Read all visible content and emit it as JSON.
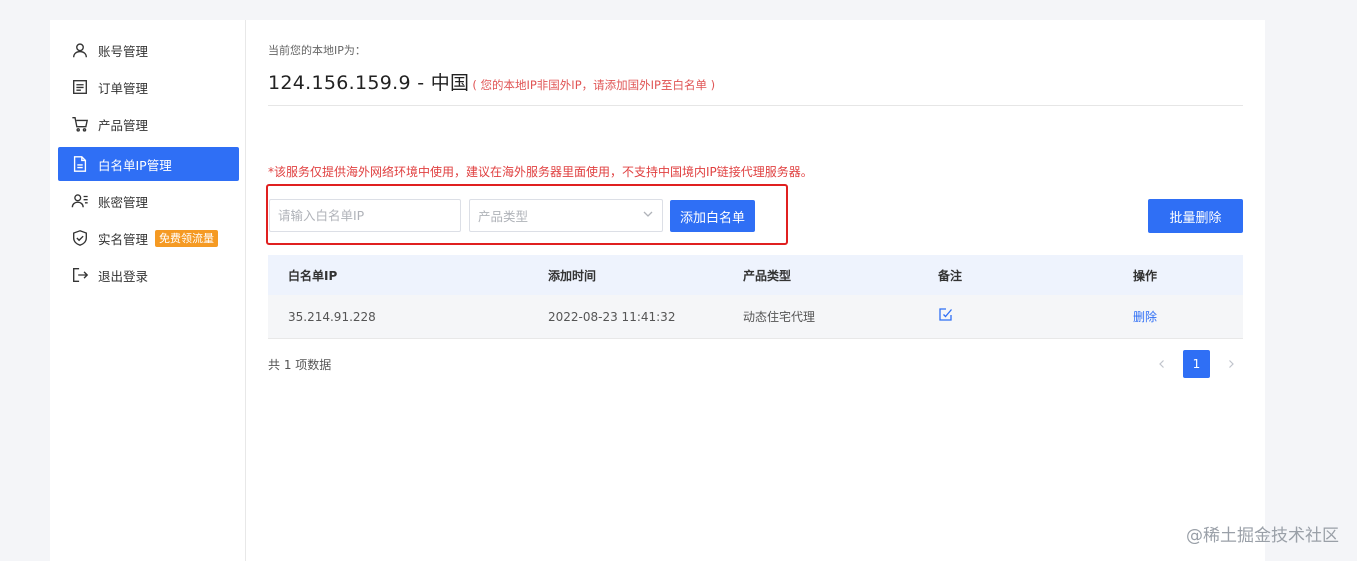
{
  "sidebar": {
    "items": [
      {
        "label": "账号管理",
        "icon": "user-icon"
      },
      {
        "label": "订单管理",
        "icon": "order-icon"
      },
      {
        "label": "产品管理",
        "icon": "cart-icon"
      },
      {
        "label": "白名单IP管理",
        "icon": "document-icon",
        "active": true
      },
      {
        "label": "账密管理",
        "icon": "user-list-icon"
      },
      {
        "label": "实名管理",
        "icon": "shield-check-icon",
        "badge": "免费领流量"
      },
      {
        "label": "退出登录",
        "icon": "logout-icon"
      }
    ]
  },
  "ip_info": {
    "label": "当前您的本地IP为：",
    "value": "124.156.159.9 - 中国",
    "note": "( 您的本地IP非国外IP，请添加国外IP至白名单 )"
  },
  "warning": "*该服务仅提供海外网络环境中使用，建议在海外服务器里面使用，不支持中国境内IP链接代理服务器。",
  "form": {
    "ip_placeholder": "请输入白名单IP",
    "product_type_placeholder": "产品类型",
    "add_button": "添加白名单"
  },
  "batch_delete_button": "批量删除",
  "table": {
    "headers": [
      "白名单IP",
      "添加时间",
      "产品类型",
      "备注",
      "操作"
    ],
    "rows": [
      {
        "ip": "35.214.91.228",
        "time": "2022-08-23 11:41:32",
        "type": "动态住宅代理",
        "remark_icon": "edit-icon",
        "action": "删除"
      }
    ]
  },
  "total_text": "共 1 项数据",
  "pagination": {
    "current": "1"
  },
  "watermark": "@稀土掘金技术社区",
  "colors": {
    "primary": "#2f6ff5",
    "warning": "#e04040",
    "badge": "#f59a23"
  }
}
